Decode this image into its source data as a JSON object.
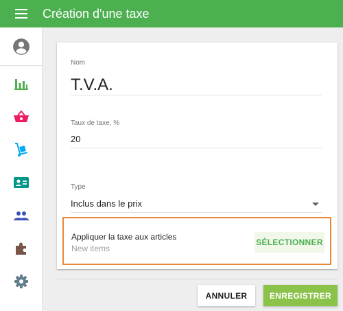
{
  "appbar": {
    "title": "Création d'une taxe",
    "color": "#4caf50"
  },
  "sidebar": {
    "items": [
      {
        "icon": "account-circle-icon"
      },
      {
        "icon": "bar-chart-icon",
        "color": "#4caf50"
      },
      {
        "icon": "basket-icon",
        "color": "#e91e63"
      },
      {
        "icon": "dolly-icon",
        "color": "#03a9f4"
      },
      {
        "icon": "badge-icon",
        "color": "#009688"
      },
      {
        "icon": "people-icon",
        "color": "#3f51b5"
      },
      {
        "icon": "puzzle-icon",
        "color": "#795548"
      },
      {
        "icon": "gear-icon",
        "color": "#607d8b"
      }
    ]
  },
  "form": {
    "name_label": "Nom",
    "name_value": "T.V.A.",
    "rate_label": "Taux de taxe, %",
    "rate_value": "20",
    "type_label": "Type",
    "type_value": "Inclus dans le prix",
    "apply_title": "Appliquer la taxe aux articles",
    "apply_sub": "New items",
    "select_label": "SÉLECTIONNER"
  },
  "actions": {
    "cancel_label": "ANNULER",
    "save_label": "ENREGISTRER"
  }
}
